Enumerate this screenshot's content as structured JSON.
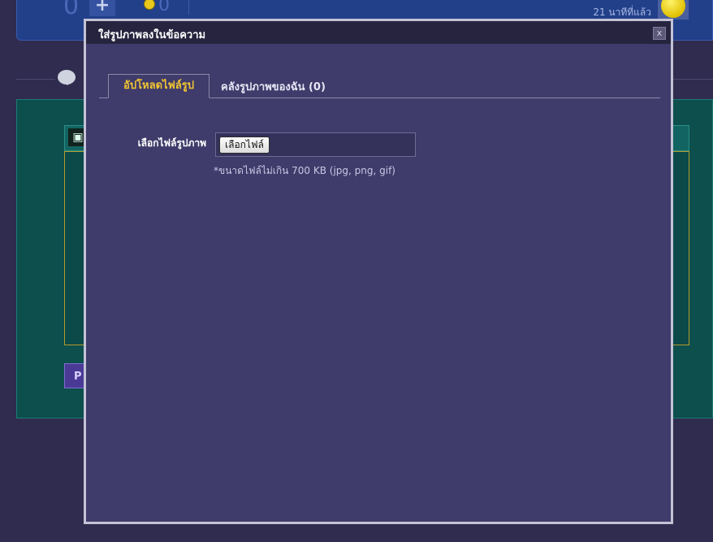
{
  "background": {
    "top_bar": {
      "count_left": "0",
      "plus_label": "+",
      "count_right": "0",
      "time_ago": "21 นาทีที่แล้ว"
    },
    "editor": {
      "camera_icon": "camera-icon",
      "submit_label": "P"
    }
  },
  "modal": {
    "title": "ใส่รูปภาพลงในข้อความ",
    "close_label": "x",
    "tabs": [
      {
        "label": "อัปโหลดไฟล์รูป",
        "active": true
      },
      {
        "label": "คลังรูปภาพของฉัน (0)",
        "active": false
      }
    ],
    "upload": {
      "field_label": "เลือกไฟล์รูปภาพ",
      "button_label": "เลือกไฟล์",
      "hint": "*ขนาดไฟล์ไม่เกิน 700 KB (jpg, png, gif)"
    }
  },
  "colors": {
    "accent_tab": "#f2c531",
    "modal_bg": "#3f3b6a",
    "header_bg": "#26243e",
    "page_bg": "#2f2c4f"
  }
}
